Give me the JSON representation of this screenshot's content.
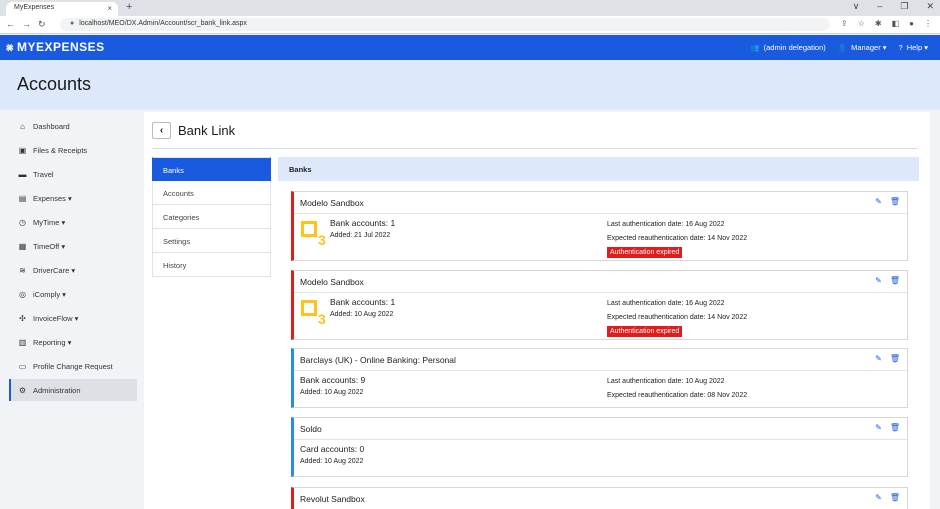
{
  "browser": {
    "tab_title": "MyExpenses",
    "tab_close": "×",
    "new_tab": "+",
    "url": "localhost/MEO/DX.Admin/Account/scr_bank_link.aspx",
    "window_controls": [
      "∨",
      "–",
      "❐",
      "✕"
    ]
  },
  "header": {
    "logo_text": "MYEXPENSES",
    "delegation": "(admin delegation)",
    "manager": "Manager ▾",
    "help": "Help ▾"
  },
  "page": {
    "title": "Accounts"
  },
  "sidebar": {
    "items": [
      {
        "label": "Dashboard",
        "icon": "home-icon",
        "glyph": "⌂"
      },
      {
        "label": "Files & Receipts",
        "icon": "image-icon",
        "glyph": "▣"
      },
      {
        "label": "Travel",
        "icon": "suitcase-icon",
        "glyph": "▬"
      },
      {
        "label": "Expenses ▾",
        "icon": "receipt-icon",
        "glyph": "▤"
      },
      {
        "label": "MyTime ▾",
        "icon": "clock-icon",
        "glyph": "◷"
      },
      {
        "label": "TimeOff ▾",
        "icon": "calendar-icon",
        "glyph": "▦"
      },
      {
        "label": "DriverCare ▾",
        "icon": "road-icon",
        "glyph": "≋"
      },
      {
        "label": "iComply ▾",
        "icon": "shield-icon",
        "glyph": "◎"
      },
      {
        "label": "InvoiceFlow ▾",
        "icon": "flow-icon",
        "glyph": "✣"
      },
      {
        "label": "Reporting ▾",
        "icon": "report-icon",
        "glyph": "▥"
      },
      {
        "label": "Profile Change Request",
        "icon": "profile-icon",
        "glyph": "▭"
      },
      {
        "label": "Administration",
        "icon": "cogs-icon",
        "glyph": "⚙"
      }
    ],
    "active_index": 11
  },
  "content": {
    "back": "‹",
    "title": "Bank Link",
    "subnav": [
      "Banks",
      "Accounts",
      "Categories",
      "Settings",
      "History"
    ],
    "subnav_active": 0,
    "banks_header": "Banks",
    "cards": [
      {
        "name": "Modelo Sandbox",
        "color": "#e21b1b",
        "logo": "o3",
        "logo_text": "3",
        "count": "Bank accounts: 1",
        "added": "Added: 21 Jul 2022",
        "last_auth": "Last authentication date: 16 Aug 2022",
        "expected": "Expected reauthentication date: 14 Nov 2022",
        "badge": "Authentication expired"
      },
      {
        "name": "Modelo Sandbox",
        "color": "#e21b1b",
        "logo": "o3",
        "logo_text": "3",
        "count": "Bank accounts: 1",
        "added": "Added: 10 Aug 2022",
        "last_auth": "Last authentication date: 16 Aug 2022",
        "expected": "Expected reauthentication date: 14 Nov 2022",
        "badge": "Authentication expired"
      },
      {
        "name": "Barclays (UK) - Online Banking: Personal",
        "color": "#2590e0",
        "count": "Bank accounts: 9",
        "added": "Added: 10 Aug 2022",
        "last_auth": "Last authentication date: 10 Aug 2022",
        "expected": "Expected reauthentication date: 08 Nov 2022"
      },
      {
        "name": "Soldo",
        "color": "#2590e0",
        "count": "Card accounts: 0",
        "added": "Added: 10 Aug 2022"
      },
      {
        "name": "Revolut Sandbox",
        "color": "#e21b1b"
      }
    ]
  }
}
